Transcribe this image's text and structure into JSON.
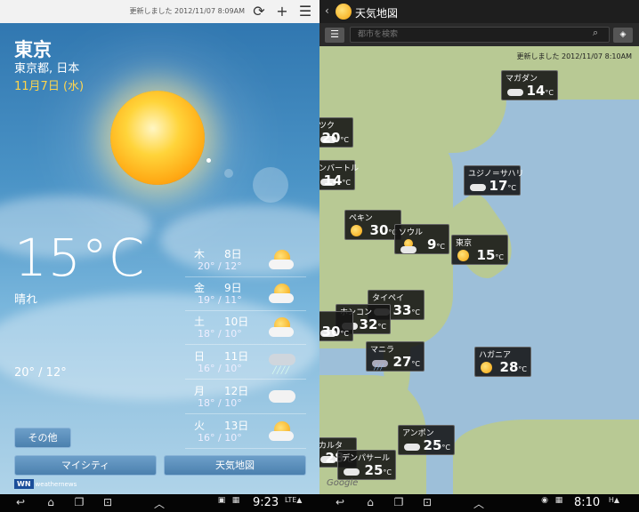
{
  "left": {
    "updated": "更新しました 2012/11/07 8:09AM",
    "city": "東京",
    "region": "東京都, 日本",
    "date": "11月7日 (水)",
    "temp": "15°C",
    "condition": "晴れ",
    "hilo": "20° / 12°",
    "forecast": [
      {
        "dow": "木",
        "day": "8日",
        "temps": "20° / 12°",
        "icon": "partly-sunny-icon"
      },
      {
        "dow": "金",
        "day": "9日",
        "temps": "19° / 11°",
        "icon": "partly-sunny-icon"
      },
      {
        "dow": "土",
        "day": "10日",
        "temps": "18° / 10°",
        "icon": "partly-sunny-icon"
      },
      {
        "dow": "日",
        "day": "11日",
        "temps": "16° / 10°",
        "icon": "rain-cloud-icon"
      },
      {
        "dow": "月",
        "day": "12日",
        "temps": "18° / 10°",
        "icon": "cloudy-icon"
      },
      {
        "dow": "火",
        "day": "13日",
        "temps": "16° / 10°",
        "icon": "partly-sunny-icon"
      }
    ],
    "other_btn": "その他",
    "mycity_btn": "マイシティ",
    "map_btn": "天気地図",
    "logo": "weathernews",
    "time": "9:23"
  },
  "right": {
    "title": "天気地図",
    "search_placeholder": "都市を検索",
    "updated": "更新しました 2012/11/07 8:10AM",
    "time": "8:10",
    "google": "Google",
    "cities": [
      {
        "name": "マガダン",
        "temp": "14",
        "icon": "cloud"
      },
      {
        "name": "ツク",
        "temp": "20",
        "icon": "cloud"
      },
      {
        "name": "ンバートル",
        "temp": "14",
        "icon": "cloud"
      },
      {
        "name": "ユジノ＝サハリ",
        "temp": "17",
        "icon": "cloud"
      },
      {
        "name": "ペキン",
        "temp": "30",
        "icon": "sun"
      },
      {
        "name": "ソウル",
        "temp": "9",
        "icon": "partly"
      },
      {
        "name": "東京",
        "temp": "15",
        "icon": "sun"
      },
      {
        "name": "タイペイ",
        "temp": "33",
        "icon": "cloud"
      },
      {
        "name": "ホンコン",
        "temp": "32",
        "icon": "cloud"
      },
      {
        "name": "",
        "temp": "30",
        "icon": "cloud"
      },
      {
        "name": "マニラ",
        "temp": "27",
        "icon": "rain"
      },
      {
        "name": "ハガニア",
        "temp": "28",
        "icon": "sun"
      },
      {
        "name": "アンポン",
        "temp": "25",
        "icon": "cloud"
      },
      {
        "name": "カルタ",
        "temp": "28",
        "icon": "cloud"
      },
      {
        "name": "デンパサール",
        "temp": "25",
        "icon": "cloud"
      }
    ],
    "unit": "°C"
  }
}
